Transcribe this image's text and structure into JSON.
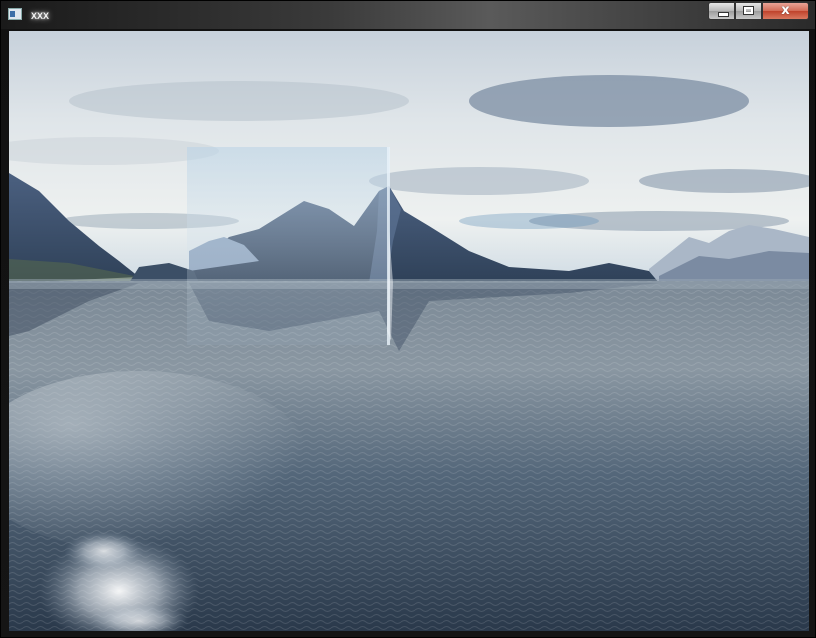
{
  "window": {
    "title": "xxx",
    "icons": {
      "app": "app-window-icon",
      "minimize": "minimize-icon",
      "maximize": "maximize-icon",
      "close": "close-icon"
    },
    "close_glyph": "x"
  },
  "scene": {
    "description_type": "3d-rendered-terrain-and-water",
    "colors": {
      "sky_top": "#c9d4dd",
      "sky_cloud": "#7e8fa3",
      "sky_horizon": "#eef2f2",
      "mountain_dark": "#33475e",
      "mountain_light": "#6d83a0",
      "water_far": "#8b97a2",
      "water_near": "#2c3a4c",
      "sun_glint": "#f4f6f8"
    }
  }
}
